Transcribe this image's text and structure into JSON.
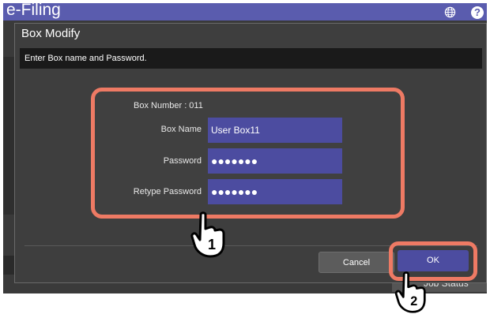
{
  "app": {
    "title": "e-Filing"
  },
  "dialog": {
    "title": "Box Modify",
    "message": "Enter Box name and Password.",
    "box_number": "Box Number : 011",
    "box_name_label": "Box Name",
    "box_name_value": "User Box11",
    "password_label": "Password",
    "password_value": "●●●●●●●",
    "retype_label": "Retype Password",
    "retype_value": "●●●●●●●",
    "cancel_label": "Cancel",
    "ok_label": "OK"
  },
  "footer": {
    "job_status": "Job Status"
  },
  "callouts": {
    "step1": "1",
    "step2": "2"
  },
  "colors": {
    "accent": "#5a5cae",
    "highlight": "#ee7a64",
    "field": "#4c4ca0"
  },
  "icons": [
    "globe-icon",
    "help-icon",
    "hand-pointer-icon"
  ]
}
